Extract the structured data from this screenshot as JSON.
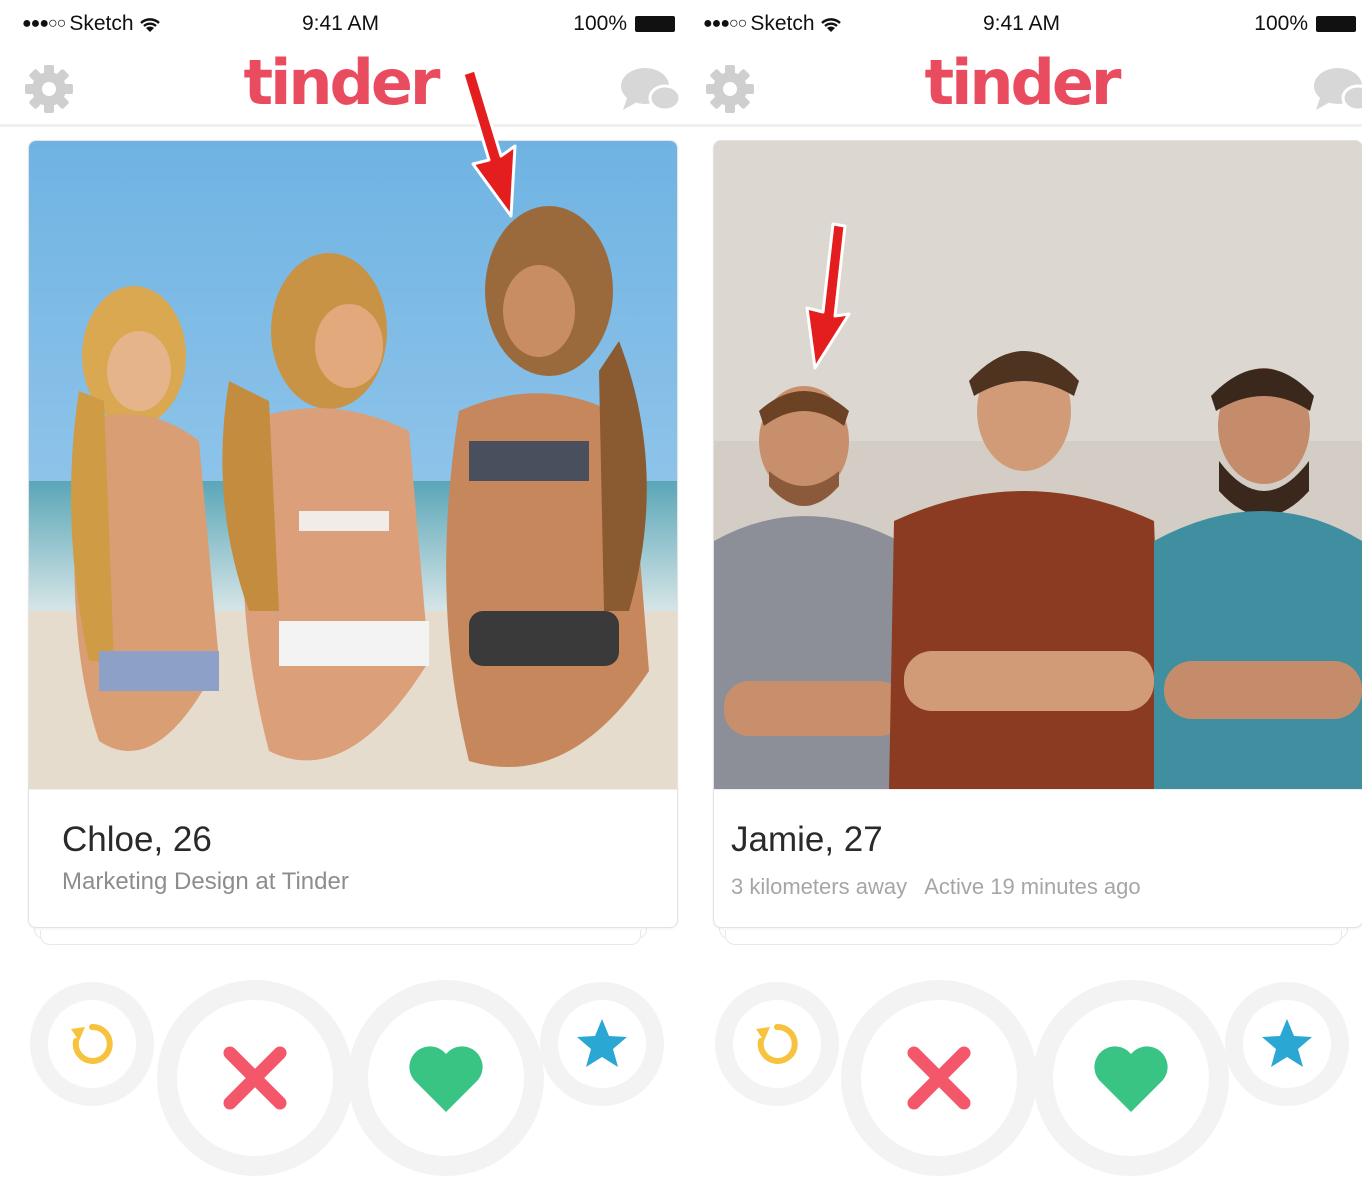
{
  "status_bar": {
    "carrier": "Sketch",
    "signal": "●●●○○",
    "time": "9:41 AM",
    "battery": "100%"
  },
  "app": {
    "logo": "tinder",
    "brand_color": "#ea4c5f"
  },
  "screens": [
    {
      "profile": {
        "name_age": "Chloe, 26",
        "subtitle": "Marketing Design at Tinder"
      },
      "photo": "three-women-on-beach",
      "annotation": "red-arrow"
    },
    {
      "profile": {
        "name_age": "Jamie, 27",
        "subtitle": "3 kilometers away   Active 19 minutes ago"
      },
      "photo": "three-men-arms-crossed",
      "annotation": "red-arrow"
    }
  ],
  "actions": [
    {
      "icon": "rewind-icon",
      "color": "#f7c33f"
    },
    {
      "icon": "nope-x-icon",
      "color": "#f4566a"
    },
    {
      "icon": "like-heart-icon",
      "color": "#39c483"
    },
    {
      "icon": "super-like-star-icon",
      "color": "#2aa7d3"
    }
  ]
}
